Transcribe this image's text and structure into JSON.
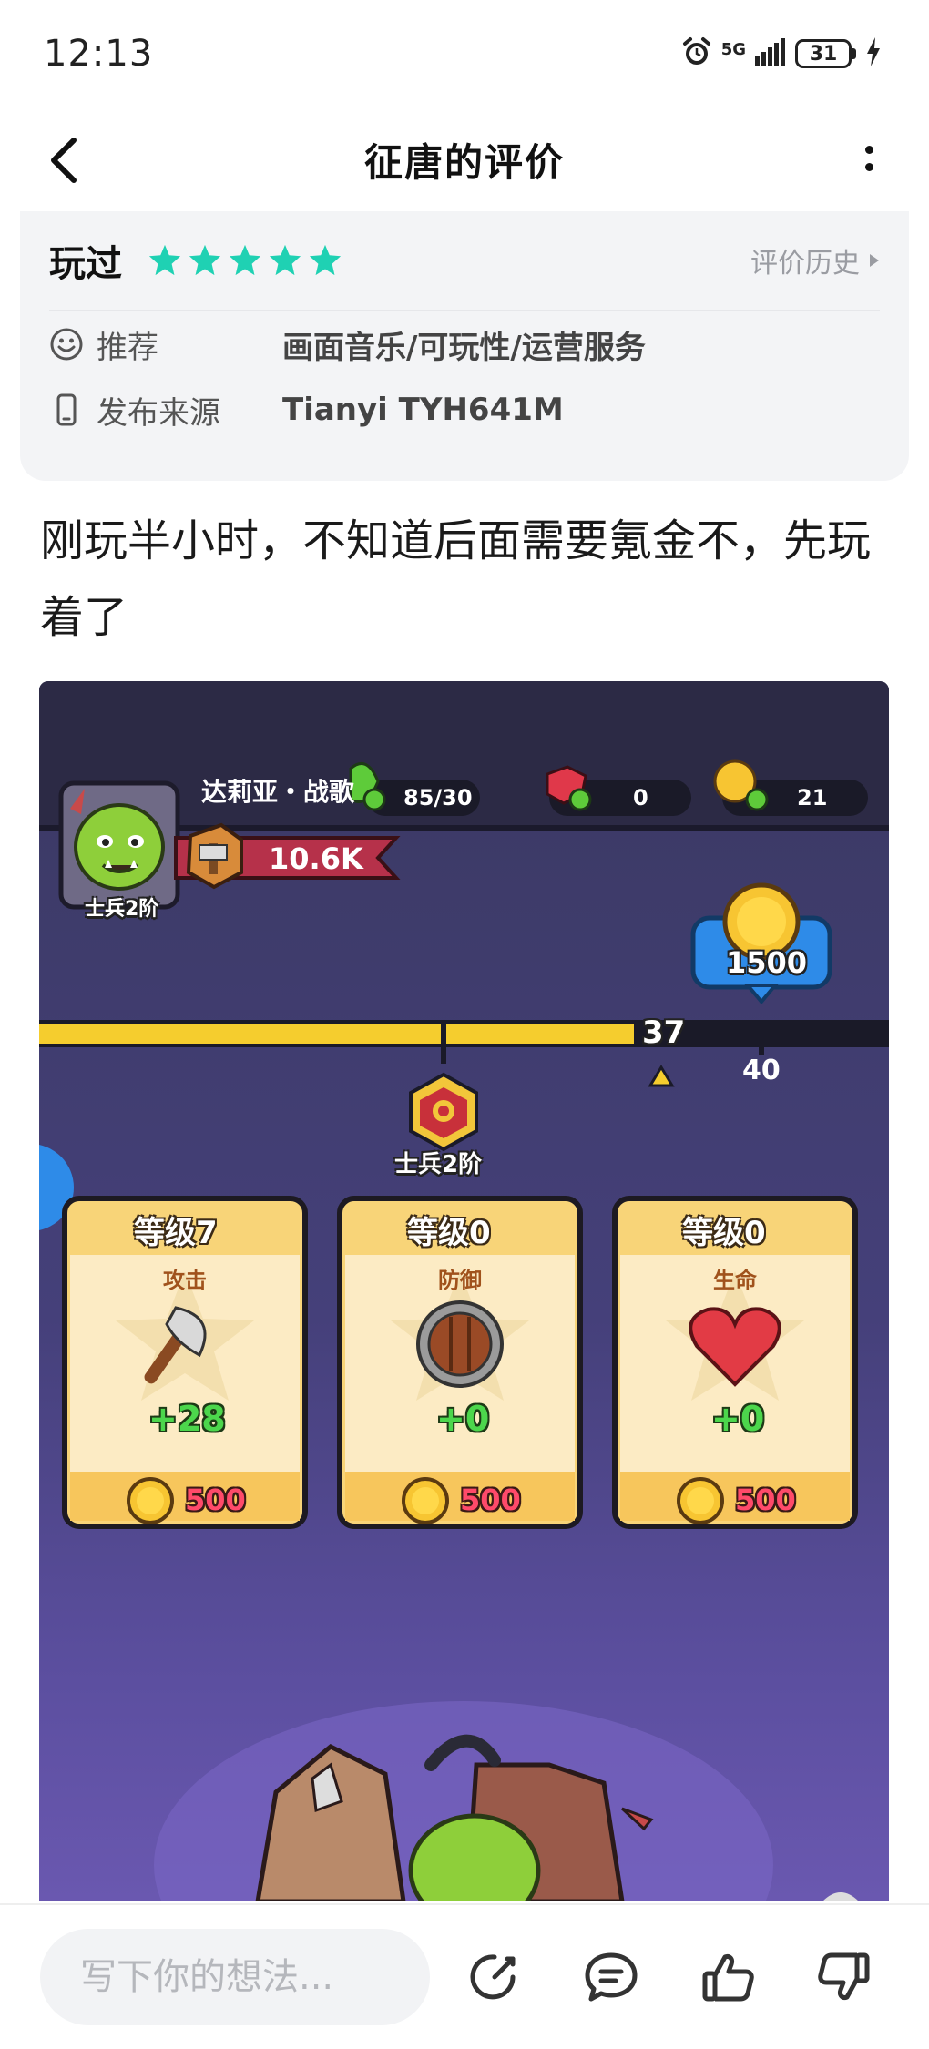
{
  "status_bar": {
    "time": "12:13",
    "network": "5G",
    "battery": "31"
  },
  "nav": {
    "title": "征唐的评价"
  },
  "review": {
    "played_label": "玩过",
    "stars": 5,
    "star_color": "#1fd1b3",
    "history_label": "评价历史",
    "meta": [
      {
        "icon": "smile-icon",
        "key": "推荐",
        "value": "画面音乐/可玩性/运营服务"
      },
      {
        "icon": "phone-icon",
        "key": "发布来源",
        "value": "Tianyi TYH641M"
      }
    ],
    "text": "刚玩半小时，不知道后面需要氪金不，先玩着了"
  },
  "game_screenshot": {
    "player_name": "达莉亚・战歌",
    "rank_label": "士兵2阶",
    "stamina": "85/30",
    "gems": "0",
    "gold": "21",
    "power": "10.6K",
    "reward_amount": "1500",
    "progress_current": "37",
    "progress_target": "40",
    "progress_fraction": 0.7,
    "milestone_label": "士兵2阶",
    "upgrade_cards": [
      {
        "level": "等级7",
        "stat": "攻击",
        "icon": "axe-icon",
        "bonus": "+28",
        "cost": "500"
      },
      {
        "level": "等级0",
        "stat": "防御",
        "icon": "shield-icon",
        "bonus": "+0",
        "cost": "500"
      },
      {
        "level": "等级0",
        "stat": "生命",
        "icon": "heart-icon",
        "bonus": "+0",
        "cost": "500"
      }
    ]
  },
  "bottom_bar": {
    "input_placeholder": "写下你的想法..."
  }
}
